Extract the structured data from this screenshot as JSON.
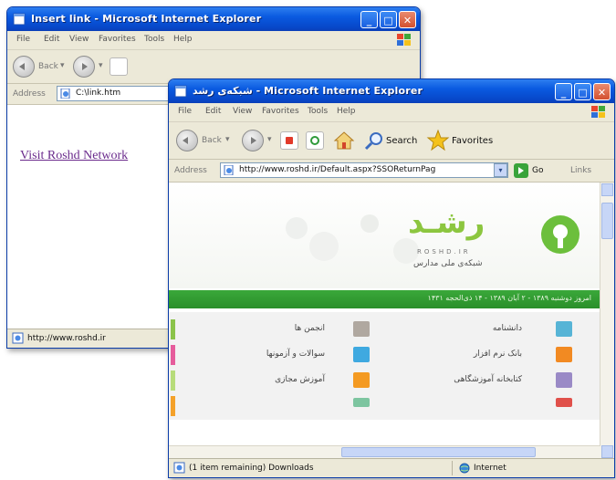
{
  "back_window": {
    "title": "Insert link - Microsoft Internet Explorer",
    "menu": [
      "File",
      "Edit",
      "View",
      "Favorites",
      "Tools",
      "Help"
    ],
    "toolbar": {
      "back_label": "Back"
    },
    "address": {
      "label": "Address",
      "value": "C:\\link.htm"
    },
    "link_text": "Visit Roshd Network",
    "status_text": "http://www.roshd.ir",
    "controls": {
      "minimize": "_",
      "maximize": "□",
      "close": "✕"
    }
  },
  "front_window": {
    "title": "شبكه‌ی رشد - Microsoft Internet Explorer",
    "menu": [
      "File",
      "Edit",
      "View",
      "Favorites",
      "Tools",
      "Help"
    ],
    "toolbar": {
      "back_label": "Back",
      "search_label": "Search",
      "favorites_label": "Favorites"
    },
    "address": {
      "label": "Address",
      "value": "http://www.roshd.ir/Default.aspx?SSOReturnPag",
      "go_label": "Go",
      "links_label": "Links"
    },
    "site": {
      "logo_text": "رشـد",
      "logo_latin": "ROSHD.IR",
      "logo_subtitle": "شبکه‌ی ملی مدارس",
      "green_bar_text": "امروز دوشنبه ۱۳۸۹ - ۲ آبان ۱۳۸۹ - ۱۴ ذی‌الحجه ۱۴۳۱",
      "categories_right": [
        "دانشنامه",
        "بانک نرم افزار",
        "کتابخانه آموزشگاهی"
      ],
      "categories_left": [
        "انجمن ها",
        "سوالات و آزمونها",
        "آموزش مجازی"
      ]
    },
    "status_text": "(1 item remaining) Downloads",
    "status_zone": "Internet",
    "controls": {
      "minimize": "_",
      "maximize": "□",
      "close": "✕"
    }
  },
  "colors": {
    "titlebar": "#0a5ae0",
    "roshd_green": "#2e9e2a",
    "link": "#551a8b"
  }
}
